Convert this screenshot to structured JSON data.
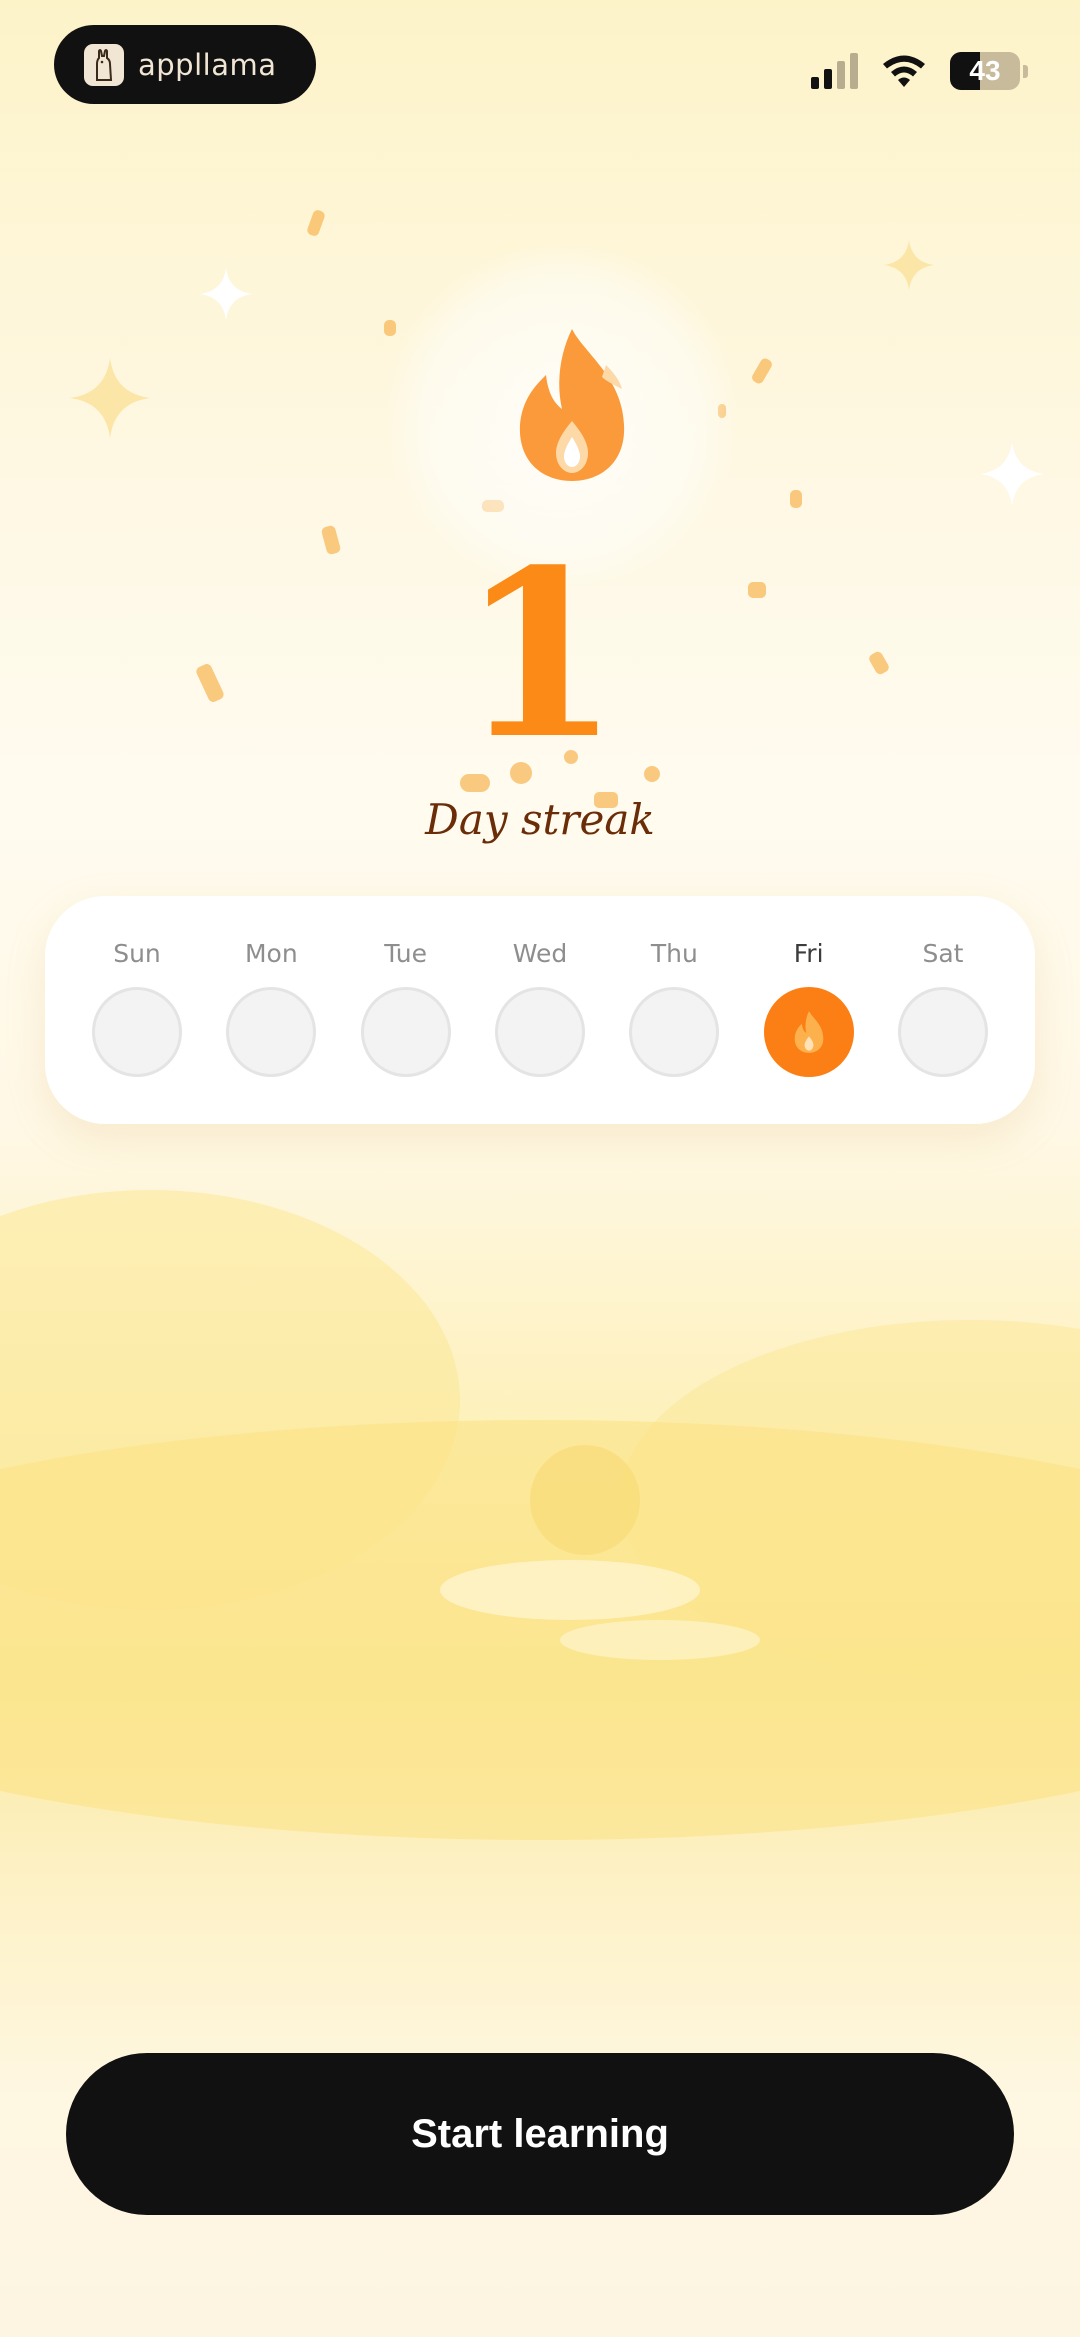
{
  "status_bar": {
    "app_name": "appllama",
    "logo_icon": "llama-icon",
    "battery_level": "43",
    "signal_bars_active": 2,
    "signal_bars_total": 4
  },
  "hero": {
    "icon": "flame-icon",
    "streak_count": "1",
    "streak_label": "Day streak"
  },
  "week": {
    "days": [
      {
        "label": "Sun",
        "completed": false
      },
      {
        "label": "Mon",
        "completed": false
      },
      {
        "label": "Tue",
        "completed": false
      },
      {
        "label": "Wed",
        "completed": false
      },
      {
        "label": "Thu",
        "completed": false
      },
      {
        "label": "Fri",
        "completed": true
      },
      {
        "label": "Sat",
        "completed": false
      }
    ]
  },
  "cta": {
    "label": "Start learning"
  },
  "colors": {
    "accent": "#fb7f14",
    "streak_text": "#fb8a16",
    "label_text": "#6a2d08",
    "button_bg": "#111111"
  }
}
